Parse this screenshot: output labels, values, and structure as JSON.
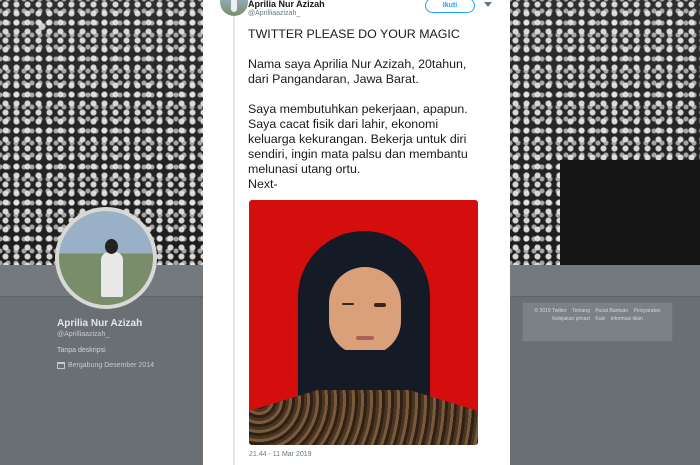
{
  "profile": {
    "name": "Aprilia Nur Azizah",
    "handle": "@Aprilliaazizah_",
    "description": "Tanpa deskripsi",
    "joined": "Bergabung Desember 2014"
  },
  "footer": {
    "links": [
      "© 2019 Twitter",
      "Tentang",
      "Pusat Bantuan",
      "Persyaratan",
      "Kebijakan privasi",
      "Kuki",
      "Informasi iklan"
    ]
  },
  "tweet": {
    "author_name": "Aprilia Nur Azizah",
    "author_handle": "@Aprilliaazizah_",
    "follow_label": "Ikuti",
    "text": "TWITTER PLEASE DO YOUR MAGIC\n\nNama saya Aprilia Nur Azizah, 20tahun,\ndari Pangandaran, Jawa Barat.\n\nSaya membutuhkan pekerjaan, apapun.\nSaya cacat fisik dari lahir, ekonomi\nkeluarga kekurangan. Bekerja untuk diri\nsendiri, ingin mata palsu dan membantu\nmelunasi utang ortu.\nNext-",
    "timestamp": "21.44 - 11 Mar 2019"
  },
  "colors": {
    "accent": "#1da1f2",
    "photo_background": "#d40d0d"
  }
}
